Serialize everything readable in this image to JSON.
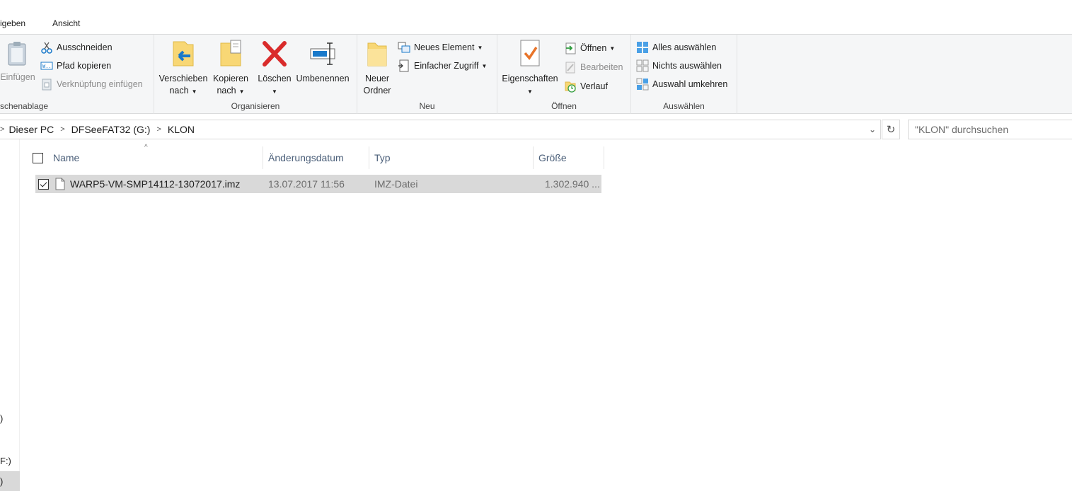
{
  "tabs": [
    {
      "label": "igeben"
    },
    {
      "label": "Ansicht"
    }
  ],
  "ribbon": {
    "clipboard": {
      "label": "schenablage",
      "paste_label": "Einfügen",
      "cut_label": "Ausschneiden",
      "copy_path_label": "Pfad kopieren",
      "paste_shortcut_label": "Verknüpfung einfügen"
    },
    "organize": {
      "label": "Organisieren",
      "move_label_1": "Verschieben",
      "move_label_2": "nach",
      "copy_label_1": "Kopieren",
      "copy_label_2": "nach",
      "delete_label": "Löschen",
      "rename_label": "Umbenennen"
    },
    "new": {
      "label": "Neu",
      "new_folder_1": "Neuer",
      "new_folder_2": "Ordner",
      "new_item_label": "Neues Element",
      "easy_access_label": "Einfacher Zugriff"
    },
    "open": {
      "label": "Öffnen",
      "properties_label": "Eigenschaften",
      "open_label": "Öffnen",
      "edit_label": "Bearbeiten",
      "history_label": "Verlauf"
    },
    "select": {
      "label": "Auswählen",
      "select_all_label": "Alles auswählen",
      "select_none_label": "Nichts auswählen",
      "invert_label": "Auswahl umkehren"
    }
  },
  "address": {
    "crumbs": [
      "Dieser PC",
      "DFSeeFAT32 (G:)",
      "KLON"
    ],
    "search_placeholder": "\"KLON\" durchsuchen"
  },
  "nav": {
    "items": [
      ")",
      "F:)",
      ")"
    ]
  },
  "list": {
    "columns": [
      "Name",
      "Änderungsdatum",
      "Typ",
      "Größe"
    ],
    "rows": [
      {
        "name": "WARP5-VM-SMP14112-13072017.imz",
        "date": "13.07.2017 11:56",
        "type": "IMZ-Datei",
        "size": "1.302.940 ..."
      }
    ]
  },
  "colors": {
    "accent_blue": "#1979ca",
    "delete_red": "#d92b2b",
    "folder_yellow": "#f8d775",
    "ribbon_bg": "#f5f6f7",
    "selected_row": "#d9d9d9"
  }
}
